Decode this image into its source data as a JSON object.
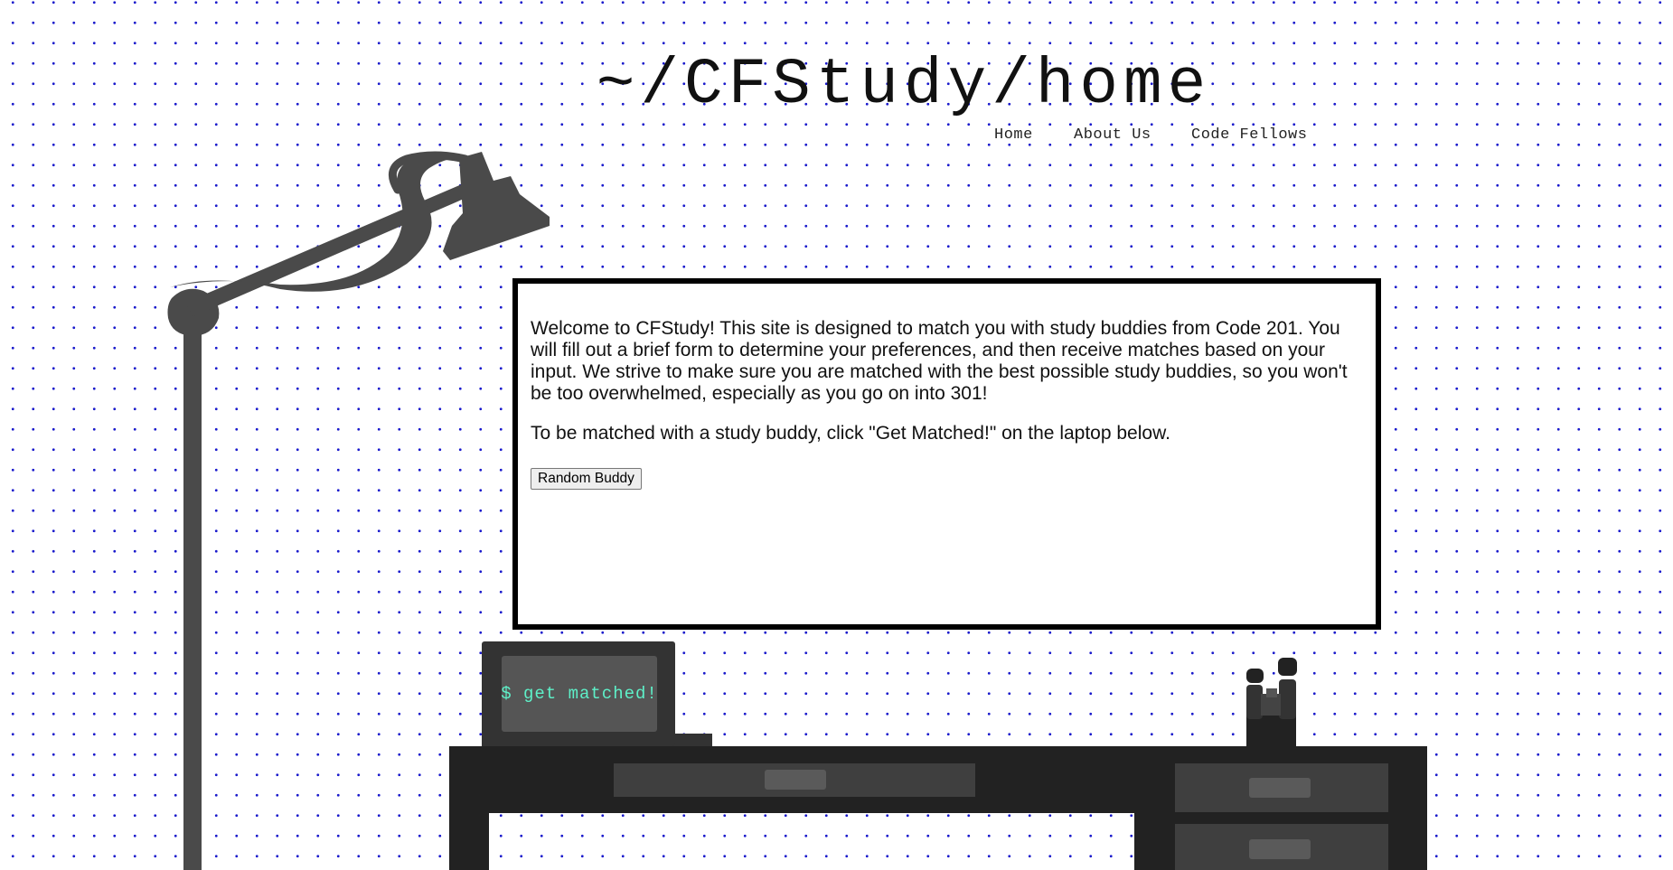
{
  "header": {
    "title": "~/CFStudy/home",
    "nav": [
      "Home",
      "About Us",
      "Code Fellows"
    ]
  },
  "board": {
    "paragraphs": [
      "Welcome to CFStudy! This site is designed to match you with study buddies from Code 201. You will fill out a brief form to determine your preferences, and then receive matches based on your input. We strive to make sure you are matched with the best possible study buddies, so you won't be too overwhelmed, especially as you go on into 301!",
      "To be matched with a study buddy, click \"Get Matched!\" on the laptop below."
    ],
    "button_label": "Random Buddy"
  },
  "laptop": {
    "screen_text": "$ get matched!"
  },
  "colors": {
    "dot_grid": "#1a1acc",
    "furniture": "#222222",
    "lamp": "#4a4a4a",
    "terminal_text": "#5ef0c8"
  },
  "icons": [
    "desk-lamp-icon",
    "binoculars-icon",
    "laptop-icon"
  ]
}
